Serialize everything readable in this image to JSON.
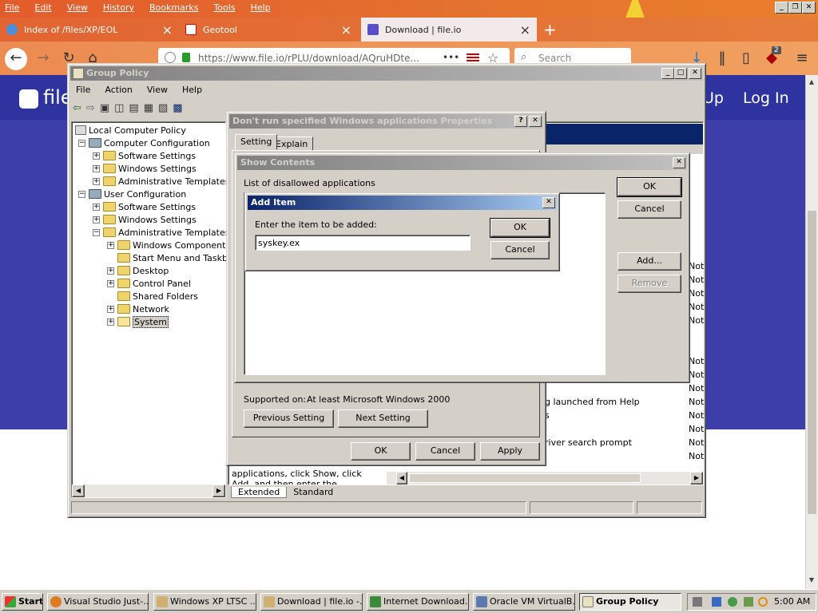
{
  "browser": {
    "menu": [
      "File",
      "Edit",
      "View",
      "History",
      "Bookmarks",
      "Tools",
      "Help"
    ],
    "tabs": [
      {
        "label": "Index of /files/XP/EOL",
        "close": "×"
      },
      {
        "label": "Geotool",
        "close": "×"
      },
      {
        "label": "Download | file.io",
        "close": "×"
      }
    ],
    "new_tab": "+",
    "url": "https://www.file.io/rPLU/download/AQruHDte...",
    "url_more": "•••",
    "search_placeholder": "Search",
    "badge_count": "2"
  },
  "site": {
    "logo": "file",
    "nav_up": "Up",
    "nav_login": "Log In"
  },
  "group_policy": {
    "title": "Group Policy",
    "menu": [
      "File",
      "Action",
      "View",
      "Help"
    ],
    "tree": [
      {
        "label": "Local Computer Policy"
      },
      {
        "label": "Computer Configuration"
      },
      {
        "label": "Software Settings"
      },
      {
        "label": "Windows Settings"
      },
      {
        "label": "Administrative Templates"
      },
      {
        "label": "User Configuration"
      },
      {
        "label": "Software Settings"
      },
      {
        "label": "Windows Settings"
      },
      {
        "label": "Administrative Templates"
      },
      {
        "label": "Windows Components"
      },
      {
        "label": "Start Menu and Taskba"
      },
      {
        "label": "Desktop"
      },
      {
        "label": "Control Panel"
      },
      {
        "label": "Shared Folders"
      },
      {
        "label": "Network"
      },
      {
        "label": "System"
      }
    ],
    "right_states": [
      "Not",
      "Not",
      "Not",
      "Not",
      "Not",
      "Not",
      "Not",
      "Not",
      "Not",
      "Not",
      "Not",
      "Not",
      "Not"
    ],
    "right_rows": [
      "g launched from Help",
      "s",
      "river search prompt"
    ],
    "desc_text": "applications, click Show, click Add, and then enter the application",
    "tabs": [
      "Extended",
      "Standard"
    ]
  },
  "properties_dialog": {
    "title": "Don't run specified Windows applications Properties",
    "help_btn": "?",
    "tabs": [
      "Setting",
      "Explain"
    ],
    "supported_label": "Supported on:",
    "supported_value": "At least Microsoft Windows 2000",
    "prev_btn": "Previous Setting",
    "next_btn": "Next Setting",
    "ok": "OK",
    "cancel": "Cancel",
    "apply": "Apply"
  },
  "show_contents": {
    "title": "Show Contents",
    "list_label": "List of disallowed applications",
    "ok": "OK",
    "cancel": "Cancel",
    "add": "Add...",
    "remove": "Remove"
  },
  "add_item": {
    "title": "Add Item",
    "prompt": "Enter the item to be added:",
    "value": "syskey.ex",
    "ok": "OK",
    "cancel": "Cancel"
  },
  "taskbar": {
    "start": "Start",
    "tasks": [
      "Visual Studio Just-...",
      "Windows XP LTSC ...",
      "Download | file.io -...",
      "Internet Download...",
      "Oracle VM VirtualB...",
      "Group Policy"
    ],
    "clock": "5:00 AM"
  }
}
